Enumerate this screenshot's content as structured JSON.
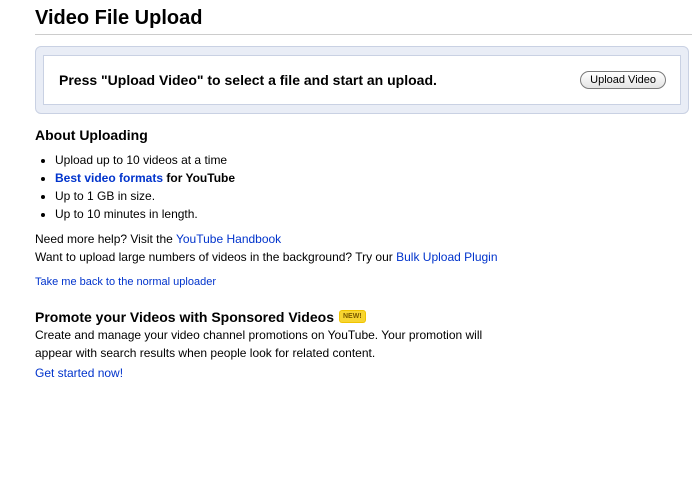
{
  "header": {
    "title": "Video File Upload"
  },
  "upload_panel": {
    "prompt": "Press \"Upload Video\" to select a file and start an upload.",
    "button_label": "Upload Video"
  },
  "about": {
    "heading": "About Uploading",
    "bullets": {
      "item1": "Upload up to 10 videos at a time",
      "item2_link": "Best video formats",
      "item2_suffix": " for YouTube",
      "item3": "Up to 1 GB in size.",
      "item4": "Up to 10 minutes in length."
    }
  },
  "help": {
    "line1_prefix": "Need more help? Visit the ",
    "line1_link": "YouTube Handbook",
    "line2_prefix": "Want to upload large numbers of videos in the background? Try our ",
    "line2_link": "Bulk Upload Plugin",
    "back_link": "Take me back to the normal uploader"
  },
  "promo": {
    "heading": "Promote your Videos with Sponsored Videos",
    "badge": "NEW!",
    "text": "Create and manage your video channel promotions on YouTube. Your promotion will appear with search results when people look for related content.",
    "cta": "Get started now!"
  },
  "colors": {
    "link": "#0033cc",
    "panel_bg": "#e9edf6",
    "panel_border": "#c9d1e3",
    "badge": "#f7d531"
  }
}
